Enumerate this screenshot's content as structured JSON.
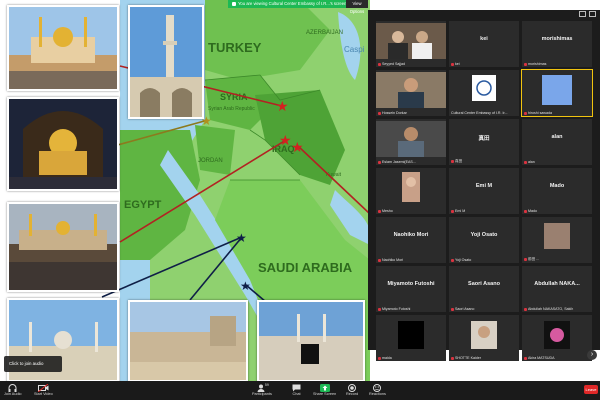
{
  "banner": {
    "share_text": "You are viewing Cultural Center Embassy of I.R...'s screen",
    "view_options": "View Options"
  },
  "map": {
    "country_labels": {
      "turkey": "TURKEY",
      "azerbaijan": "AZERBAIJAN",
      "caspian": "Caspi",
      "syria": "SYRIA",
      "syrian_arab_rep": "Syrian Arab Republic",
      "jordan": "JORDAN",
      "iraq": "IRAQ",
      "kuwait": "Kuwait",
      "egypt": "EGYPT",
      "saudi_arabia": "SAUDI ARABIA"
    }
  },
  "audio_tooltip": "Click to join audio",
  "gallery": {
    "participants": [
      {
        "label": "Seyyed Sajjad",
        "kind": "video-group",
        "muted": true
      },
      {
        "label": "kei",
        "kind": "name",
        "name": "kei",
        "muted": true
      },
      {
        "label": "morishimas",
        "kind": "name",
        "name": "morishimas",
        "muted": true
      },
      {
        "label": "Hossein Dorkar",
        "kind": "video-man",
        "muted": true
      },
      {
        "label": "Cultural Center Embassy of I.R. Ir...",
        "kind": "logo",
        "muted": false
      },
      {
        "label": "hiroshi sawada",
        "kind": "blue",
        "muted": true,
        "active": true
      },
      {
        "label": "Eslam Jasemi(EAS...",
        "kind": "video-man2",
        "muted": true
      },
      {
        "label": "真田",
        "kind": "name",
        "name": "真田",
        "muted": true
      },
      {
        "label": "alan",
        "kind": "name",
        "name": "alan",
        "muted": true
      },
      {
        "label": "Mesho",
        "kind": "video-woman",
        "muted": true
      },
      {
        "label": "Emi M",
        "kind": "name",
        "name": "Emi M",
        "muted": true
      },
      {
        "label": "Mado",
        "kind": "name",
        "name": "Mado",
        "muted": true
      },
      {
        "label": "Naohiko Mori",
        "kind": "name",
        "name": "Naohiko Mori",
        "muted": true
      },
      {
        "label": "Yoji Osato",
        "kind": "name",
        "name": "Yoji Osato",
        "muted": true
      },
      {
        "label": "前田 ...",
        "kind": "photo-blur",
        "muted": true
      },
      {
        "label": "Miyamoto Futoshi",
        "kind": "name",
        "name": "Miyamoto Futoshi",
        "muted": true
      },
      {
        "label": "Saori Asano",
        "kind": "name",
        "name": "Saori Asano",
        "muted": true
      },
      {
        "label": "Abdullah NAKASATO, Sakih",
        "kind": "name",
        "name": "Abdullah NAKA...",
        "muted": true
      },
      {
        "label": "maida",
        "kind": "black",
        "muted": true
      },
      {
        "label": "SHOTTE Kaider",
        "kind": "photo-man",
        "muted": true
      },
      {
        "label": "Akira MATSUDA",
        "kind": "photo-flower",
        "muted": true
      }
    ],
    "next_page": "›"
  },
  "toolbar": {
    "join_audio": "Join Audio",
    "start_video": "Start Video",
    "participants": "Participants",
    "participants_count": "59",
    "chat": "Chat",
    "share_screen": "Share Screen",
    "record": "Record",
    "reactions": "Reactions",
    "leave": "Leave"
  },
  "colors": {
    "sea": "#a3d3ee",
    "land_base": "#8fd16f",
    "land_dark": "#5fb542",
    "share_green": "#1db954",
    "leave_red": "#e02828",
    "active_outline": "#f1c40f"
  }
}
